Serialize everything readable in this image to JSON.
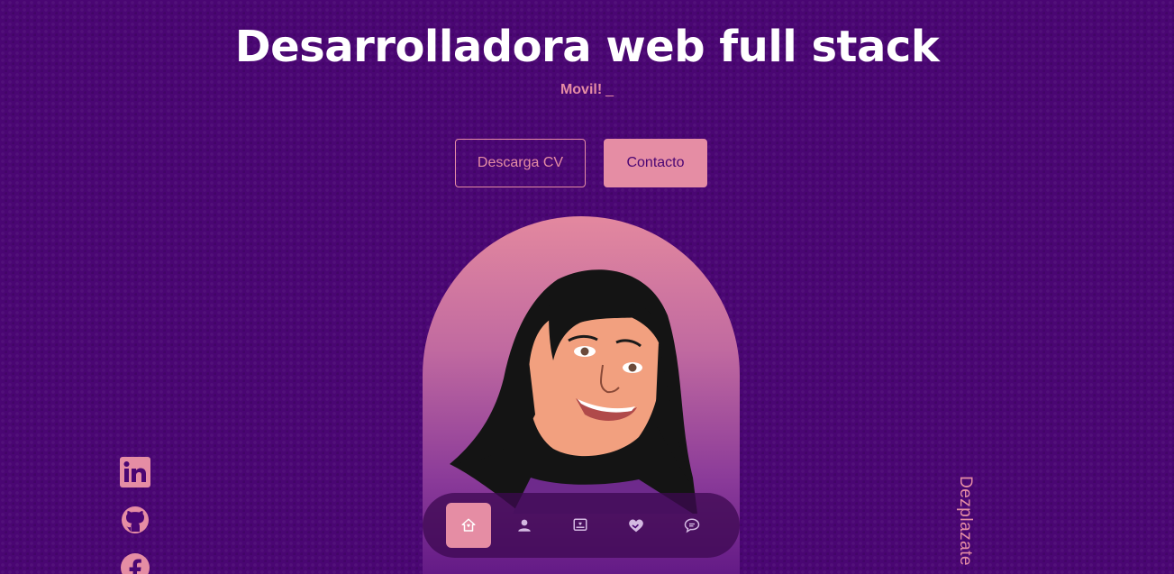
{
  "hero": {
    "headline": "Desarrolladora web full stack",
    "typing_text": "Movil!",
    "typing_cursor": "_"
  },
  "buttons": {
    "download_cv": "Descarga CV",
    "contact": "Contacto"
  },
  "nav": {
    "items": [
      {
        "icon": "home-icon",
        "active": true
      },
      {
        "icon": "user-icon",
        "active": false
      },
      {
        "icon": "portfolio-icon",
        "active": false
      },
      {
        "icon": "heart-handshake-icon",
        "active": false
      },
      {
        "icon": "message-icon",
        "active": false
      }
    ]
  },
  "socials": [
    "linkedin-icon",
    "github-icon",
    "facebook-icon"
  ],
  "scroll_hint": "Dezplazate",
  "colors": {
    "background": "#4a0673",
    "accent": "#e58da4",
    "text": "#ffffff"
  }
}
